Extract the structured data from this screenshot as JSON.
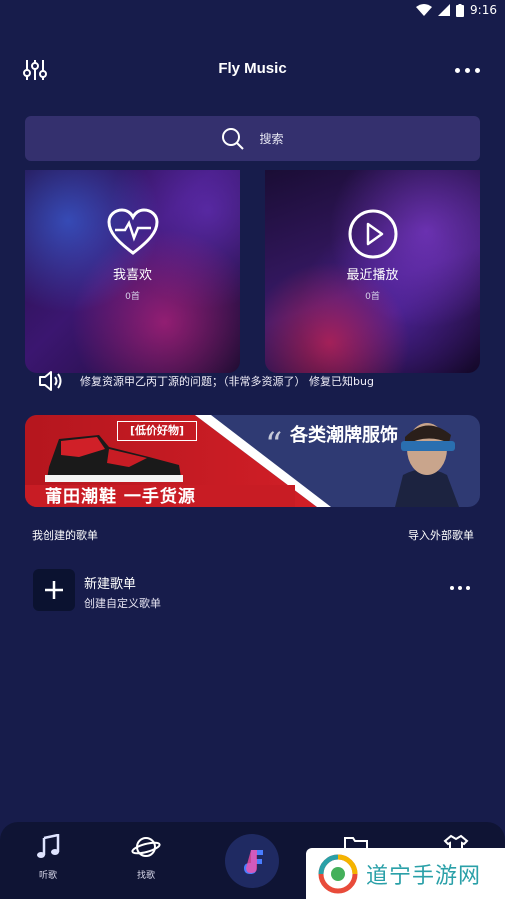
{
  "status_bar": {
    "time": "9:16"
  },
  "header": {
    "title": "Fly Music"
  },
  "search": {
    "placeholder": "搜索"
  },
  "cards": [
    {
      "title": "我喜欢",
      "count": "0首"
    },
    {
      "title": "最近播放",
      "count": "0首"
    }
  ],
  "notice": {
    "text": "修复资源甲乙丙丁源的问题；（非常多资源了） 修复已知bug"
  },
  "banner": {
    "tag": "[低价好物]",
    "slogan": "莆田潮鞋 一手货源",
    "headline": "各类潮牌服饰"
  },
  "section": {
    "title": "我创建的歌单",
    "action": "导入外部歌单"
  },
  "playlist_item": {
    "title": "新建歌单",
    "subtitle": "创建自定义歌单"
  },
  "tabs": [
    {
      "label": "听歌"
    },
    {
      "label": "找歌"
    }
  ],
  "watermark": {
    "text": "道宁手游网"
  },
  "colors": {
    "background": "#171c4b",
    "search_bg": "#34306e",
    "tabbar_bg": "#0f1434",
    "banner_red": "#c81c24"
  }
}
